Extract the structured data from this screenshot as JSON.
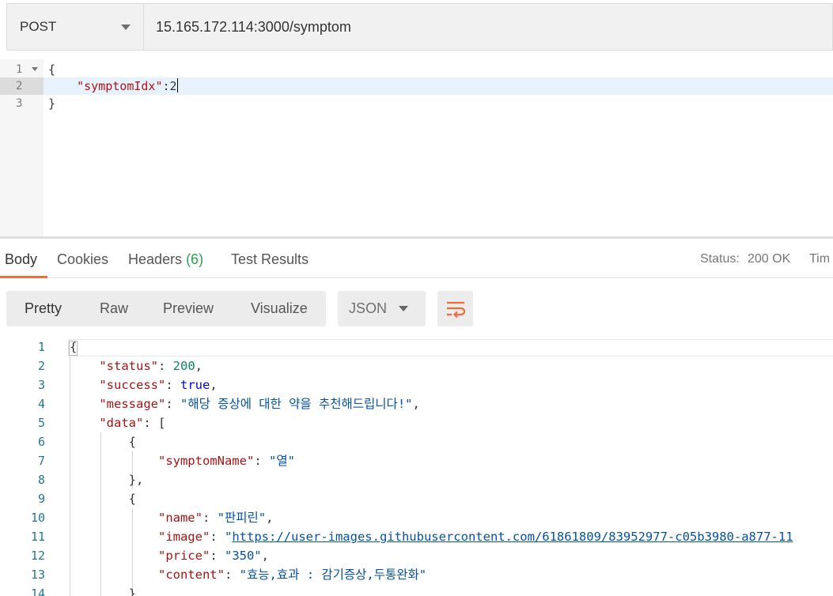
{
  "request": {
    "method": "POST",
    "url": "15.165.172.114:3000/symptom",
    "body_lines": [
      {
        "num": "1",
        "text": "{"
      },
      {
        "num": "2",
        "key": "\"symptomIdx\"",
        "sep": ":",
        "value": "2"
      },
      {
        "num": "3",
        "text": "}"
      }
    ]
  },
  "response_tabs": {
    "body": "Body",
    "cookies": "Cookies",
    "headers": "Headers",
    "headers_count": "(6)",
    "test_results": "Test Results",
    "status_label": "Status:",
    "status_value": "200 OK",
    "time_label": "Tim"
  },
  "view_modes": {
    "pretty": "Pretty",
    "raw": "Raw",
    "preview": "Preview",
    "visualize": "Visualize",
    "format": "JSON"
  },
  "response_lines": [
    {
      "num": "1",
      "parts": [
        [
          "p",
          "{"
        ]
      ]
    },
    {
      "num": "2",
      "parts": [
        [
          "p",
          "    "
        ],
        [
          "k",
          "\"status\""
        ],
        [
          "p",
          ": "
        ],
        [
          "n",
          "200"
        ],
        [
          "p",
          ","
        ]
      ]
    },
    {
      "num": "3",
      "parts": [
        [
          "p",
          "    "
        ],
        [
          "k",
          "\"success\""
        ],
        [
          "p",
          ": "
        ],
        [
          "b",
          "true"
        ],
        [
          "p",
          ","
        ]
      ]
    },
    {
      "num": "4",
      "parts": [
        [
          "p",
          "    "
        ],
        [
          "k",
          "\"message\""
        ],
        [
          "p",
          ": "
        ],
        [
          "s",
          "\"해당 증상에 대한 약을 추천해드립니다!\""
        ],
        [
          "p",
          ","
        ]
      ]
    },
    {
      "num": "5",
      "parts": [
        [
          "p",
          "    "
        ],
        [
          "k",
          "\"data\""
        ],
        [
          "p",
          ": ["
        ]
      ]
    },
    {
      "num": "6",
      "parts": [
        [
          "p",
          "        {"
        ]
      ]
    },
    {
      "num": "7",
      "parts": [
        [
          "p",
          "            "
        ],
        [
          "k",
          "\"symptomName\""
        ],
        [
          "p",
          ": "
        ],
        [
          "s",
          "\"열\""
        ]
      ]
    },
    {
      "num": "8",
      "parts": [
        [
          "p",
          "        },"
        ]
      ]
    },
    {
      "num": "9",
      "parts": [
        [
          "p",
          "        {"
        ]
      ]
    },
    {
      "num": "10",
      "parts": [
        [
          "p",
          "            "
        ],
        [
          "k",
          "\"name\""
        ],
        [
          "p",
          ": "
        ],
        [
          "s",
          "\"판피린\""
        ],
        [
          "p",
          ","
        ]
      ]
    },
    {
      "num": "11",
      "parts": [
        [
          "p",
          "            "
        ],
        [
          "k",
          "\"image\""
        ],
        [
          "p",
          ": "
        ],
        [
          "s",
          "\""
        ],
        [
          "l",
          "https://user-images.githubusercontent.com/61861809/83952977-c05b3980-a877-11"
        ]
      ]
    },
    {
      "num": "12",
      "parts": [
        [
          "p",
          "            "
        ],
        [
          "k",
          "\"price\""
        ],
        [
          "p",
          ": "
        ],
        [
          "s",
          "\"350\""
        ],
        [
          "p",
          ","
        ]
      ]
    },
    {
      "num": "13",
      "parts": [
        [
          "p",
          "            "
        ],
        [
          "k",
          "\"content\""
        ],
        [
          "p",
          ": "
        ],
        [
          "s",
          "\"효능,효과 : 감기증상,두통완화\""
        ]
      ]
    },
    {
      "num": "14",
      "parts": [
        [
          "p",
          "        }"
        ]
      ]
    }
  ],
  "colors": {
    "accent": "#f26b3a",
    "status_ok": "#2ea050"
  },
  "icons": {
    "method_dropdown": "chevron-down-icon",
    "format_dropdown": "chevron-down-icon",
    "wrap": "wrap-lines-icon"
  }
}
